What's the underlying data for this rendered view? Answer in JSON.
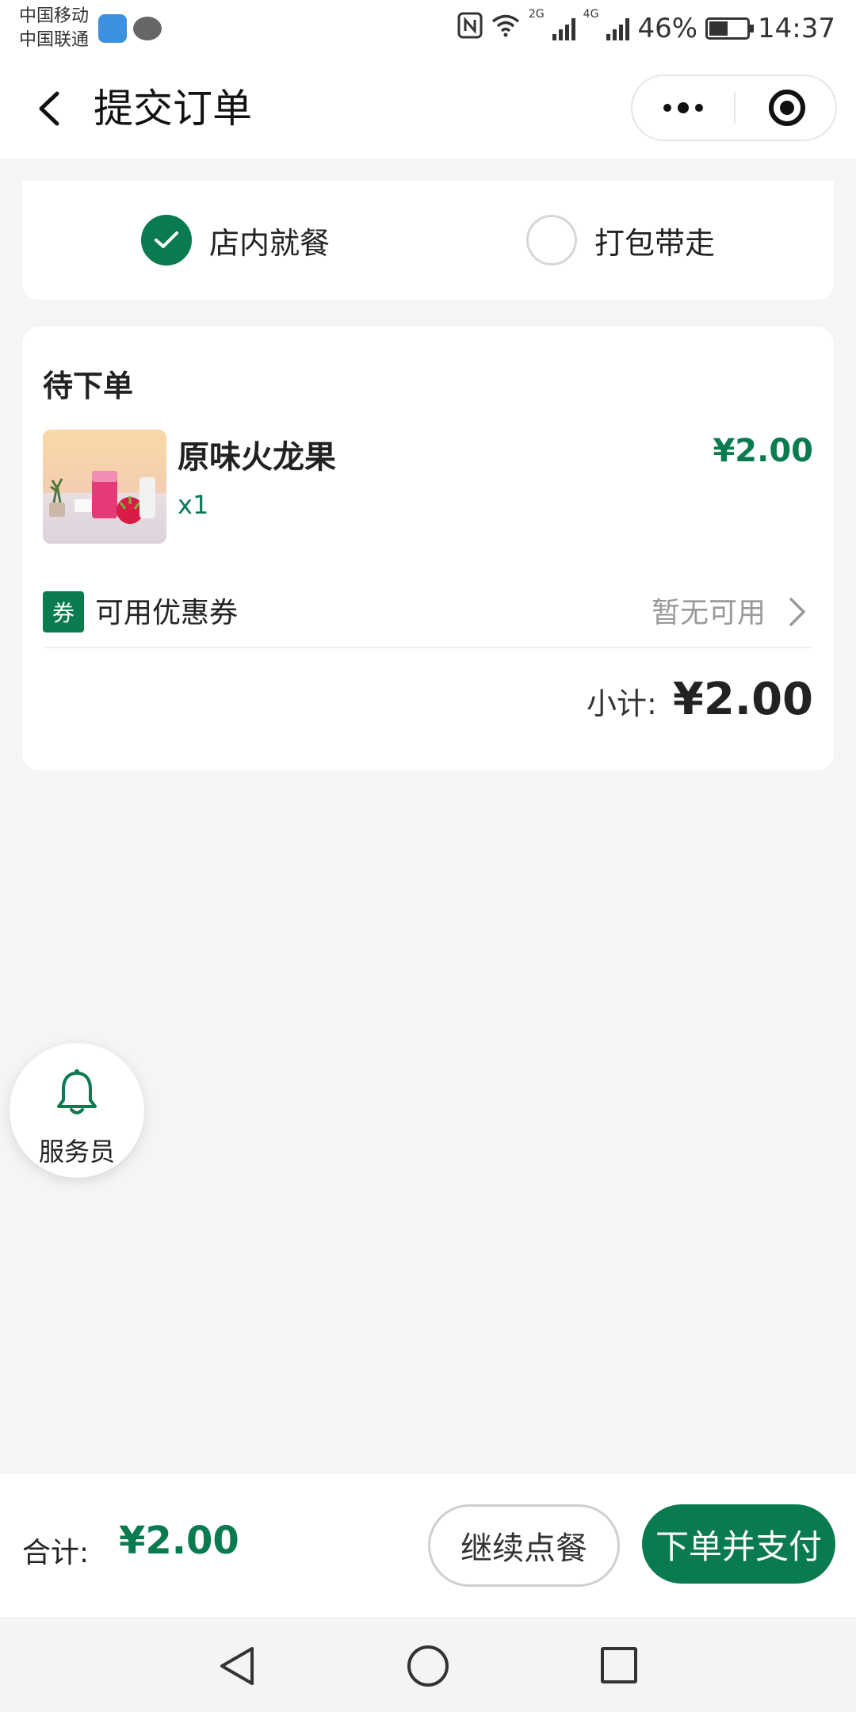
{
  "status_bar": {
    "carrier_1": "中国移动",
    "carrier_2": "中国联通",
    "net_2g": "2G",
    "net_4g": "4G",
    "battery": "46%",
    "time": "14:37"
  },
  "nav": {
    "title": "提交订单"
  },
  "dine_options": [
    {
      "label": "店内就餐",
      "selected": true
    },
    {
      "label": "打包带走",
      "selected": false
    }
  ],
  "order": {
    "section_title": "待下单",
    "item": {
      "name": "原味火龙果",
      "qty": "x1",
      "price": "¥2.00"
    },
    "coupon": {
      "badge": "券",
      "label": "可用优惠券",
      "value": "暂无可用"
    },
    "subtotal": {
      "label": "小计:",
      "value": "¥2.00"
    }
  },
  "waiter": {
    "label": "服务员"
  },
  "footer": {
    "total_label": "合计:",
    "total_value": "¥2.00",
    "continue_label": "继续点餐",
    "pay_label": "下单并支付"
  },
  "colors": {
    "accent": "#0a7a4f",
    "background": "#f5f5f5"
  }
}
